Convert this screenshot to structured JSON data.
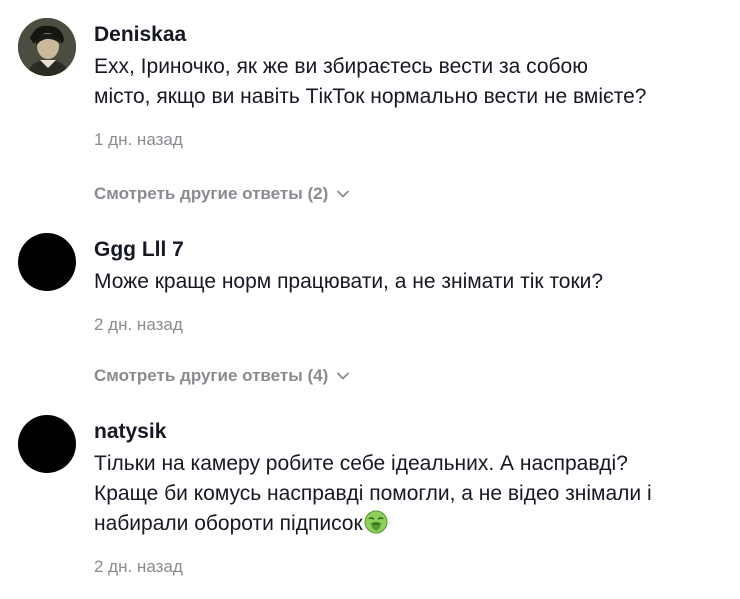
{
  "comments": [
    {
      "username": "Deniskaa",
      "text": "Ехх, Іриночко, як же ви збираєтесь вести за собою\nмісто, якщо ви навіть ТікТок нормально вести не вмієте?",
      "time": "1 дн. назад",
      "replies_label": "Смотреть другие ответы (2)",
      "avatar": "profile-photo"
    },
    {
      "username": "Ggg Lll 7",
      "text": "Може краще норм працювати, а не знімати тік токи?",
      "time": "2 дн. назад",
      "replies_label": "Смотреть другие ответы (4)",
      "avatar": "black-circle"
    },
    {
      "username": "natysik",
      "text": "Тільки на камеру робите себе ідеальних. А насправді?\nКраще би комусь насправді помогли, а не відео знімали і\nнабирали обороти підписок",
      "time": "2 дн. назад",
      "emoji": "nauseated-face-icon",
      "avatar": "black-circle"
    }
  ],
  "icons": {
    "chevron": "chevron-down-icon"
  },
  "colors": {
    "text": "#161823",
    "secondary": "#8a8b91",
    "background": "#ffffff",
    "emoji": "#5fb548"
  }
}
